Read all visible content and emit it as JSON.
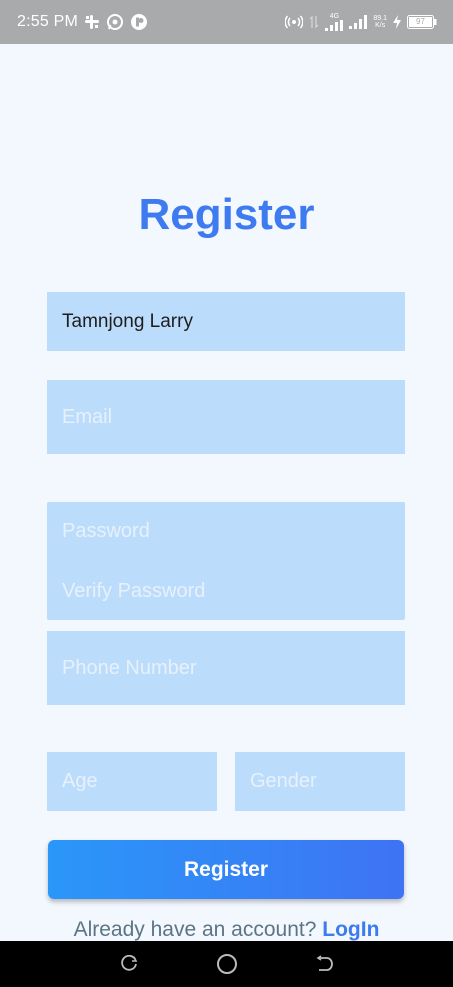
{
  "status_bar": {
    "time": "2:55 PM",
    "network": "4G",
    "speed_value": "89.1",
    "speed_unit": "K/s",
    "battery": "97",
    "icons": [
      "slack-icon",
      "whatsapp-icon",
      "app-notification-icon",
      "hotspot-icon",
      "signal-icon",
      "charging-icon",
      "battery-icon"
    ]
  },
  "form": {
    "title": "Register",
    "name_value": "Tamnjong Larry",
    "email_placeholder": "Email",
    "password_placeholder": "Password",
    "verify_password_placeholder": "Verify Password",
    "phone_placeholder": "Phone Number",
    "age_placeholder": "Age",
    "gender_placeholder": "Gender",
    "submit_label": "Register"
  },
  "footer": {
    "prompt": "Already have an account?",
    "login_label": "LogIn"
  },
  "colors": {
    "accent": "#3e7bf0",
    "field_bg": "#bcdcfb",
    "page_bg": "#f3f7fe"
  }
}
